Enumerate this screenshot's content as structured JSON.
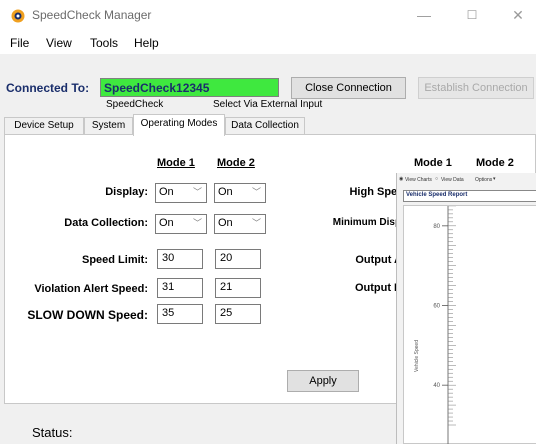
{
  "window": {
    "title": "SpeedCheck Manager",
    "icon": "speedcheck-logo-icon",
    "controls": {
      "minimize": "—",
      "maximize": "☐",
      "close": "✕"
    }
  },
  "menu": [
    "File",
    "View",
    "Tools",
    "Help"
  ],
  "connection": {
    "label": "Connected To:",
    "value": "SpeedCheck12345",
    "close_button": "Close Connection",
    "establish_button": "Establish Connection",
    "sublabel_left": "SpeedCheck",
    "sublabel_right": "Select Via External Input",
    "connected_color": "#3fe83f"
  },
  "tabs": [
    {
      "label": "Device Setup",
      "active": false
    },
    {
      "label": "System",
      "active": false
    },
    {
      "label": "Operating Modes",
      "active": true
    },
    {
      "label": "Data Collection",
      "active": false
    }
  ],
  "operating_modes": {
    "headers": [
      "Mode 1",
      "Mode 2"
    ],
    "display": {
      "label": "Display:",
      "mode1": "On",
      "mode2": "On"
    },
    "data_collection": {
      "label": "Data Collection:",
      "mode1": "On",
      "mode2": "On"
    },
    "speed_limit": {
      "label": "Speed Limit:",
      "mode1": "30",
      "mode2": "20"
    },
    "violation_alert": {
      "label": "Violation Alert Speed:",
      "mode1": "31",
      "mode2": "21"
    },
    "slow_down": {
      "label": "SLOW DOWN Speed:",
      "mode1": "35",
      "mode2": "25"
    },
    "right_headers": [
      "Mode 1",
      "Mode 2"
    ],
    "right_labels": [
      "High Speed",
      "Minimum Display",
      "Output A",
      "Output B"
    ],
    "apply_button": "Apply"
  },
  "status": {
    "label": "Status:"
  },
  "overlay": {
    "radio_view_charts": "View Charts",
    "radio_view_data": "View Data",
    "options_label": "Options",
    "tab_title": "Vehicle Speed Report",
    "y_axis_label": "Vehicle Speed",
    "chart_data": {
      "type": "line",
      "title": "",
      "xlabel": "",
      "ylabel": "Vehicle Speed",
      "y_ticks": [
        80,
        60,
        40
      ],
      "ylim": [
        30,
        90
      ],
      "grid": false,
      "legend": "none",
      "series": []
    }
  }
}
